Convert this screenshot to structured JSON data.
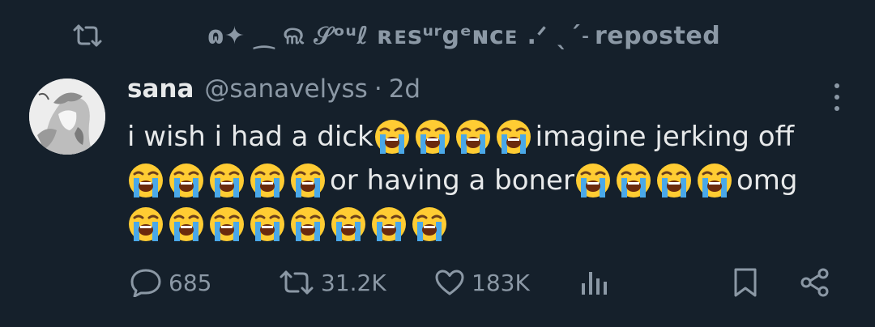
{
  "repost_banner": {
    "reposter_name": "ɷ✦ ⁔ ଲ 𝒮ᵒᵘℓ  ʀᴇsᵘʳgᵉɴᴄᴇ .ᐟ ˎˊ˗",
    "repost_suffix": "reposted"
  },
  "tweet": {
    "display_name": "sana",
    "handle": "@sanavelyss",
    "separator": "·",
    "time": "2d",
    "text_segments": {
      "line1_a": "i wish i had a dick",
      "line1_b": "imagine jerking off",
      "line2_a": "or having a boner",
      "line2_b": "omg"
    },
    "emoji": "loudly-crying-face"
  },
  "actions": {
    "replies": "685",
    "reposts": "31.2K",
    "likes": "183K"
  },
  "colors": {
    "background": "#15202b",
    "primary_text": "#e7e9ea",
    "secondary_text": "#8b98a5"
  }
}
